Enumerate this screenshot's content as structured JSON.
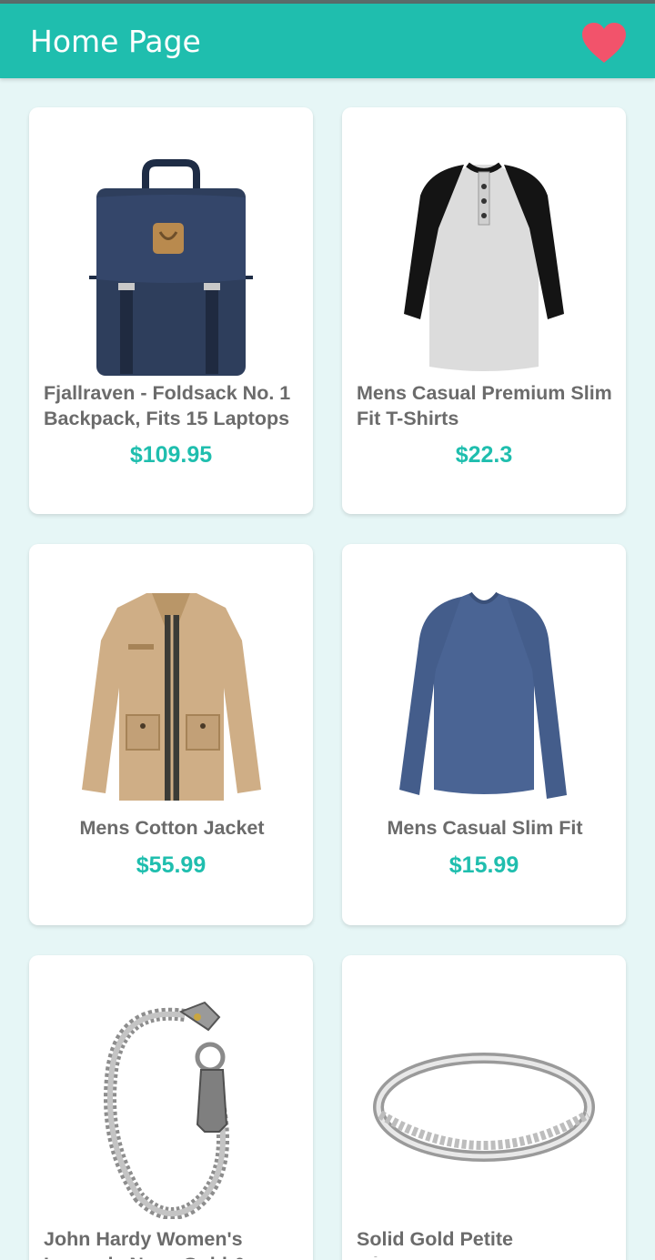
{
  "app": {
    "title": "Home Page",
    "accent_color": "#1fbeae",
    "favorites_icon": "heart-icon",
    "favorites_color": "#f2536b"
  },
  "products": [
    {
      "name": "Fjallraven - Foldsack No. 1 Backpack, Fits 15 Laptops",
      "price": "$109.95",
      "image": "backpack"
    },
    {
      "name": "Mens Casual Premium Slim Fit T-Shirts",
      "price": "$22.3",
      "image": "raglan-tshirt"
    },
    {
      "name": "Mens Cotton Jacket",
      "price": "$55.99",
      "image": "cotton-jacket"
    },
    {
      "name": "Mens Casual Slim Fit",
      "price": "$15.99",
      "image": "long-sleeve-shirt"
    },
    {
      "name": "John Hardy Women's Legends Naga Gold & Silver Dragon Station Chain Bracelet",
      "price": "",
      "image": "dragon-bracelet"
    },
    {
      "name": "Solid Gold Petite Micropave",
      "price": "",
      "image": "silver-ring"
    }
  ]
}
